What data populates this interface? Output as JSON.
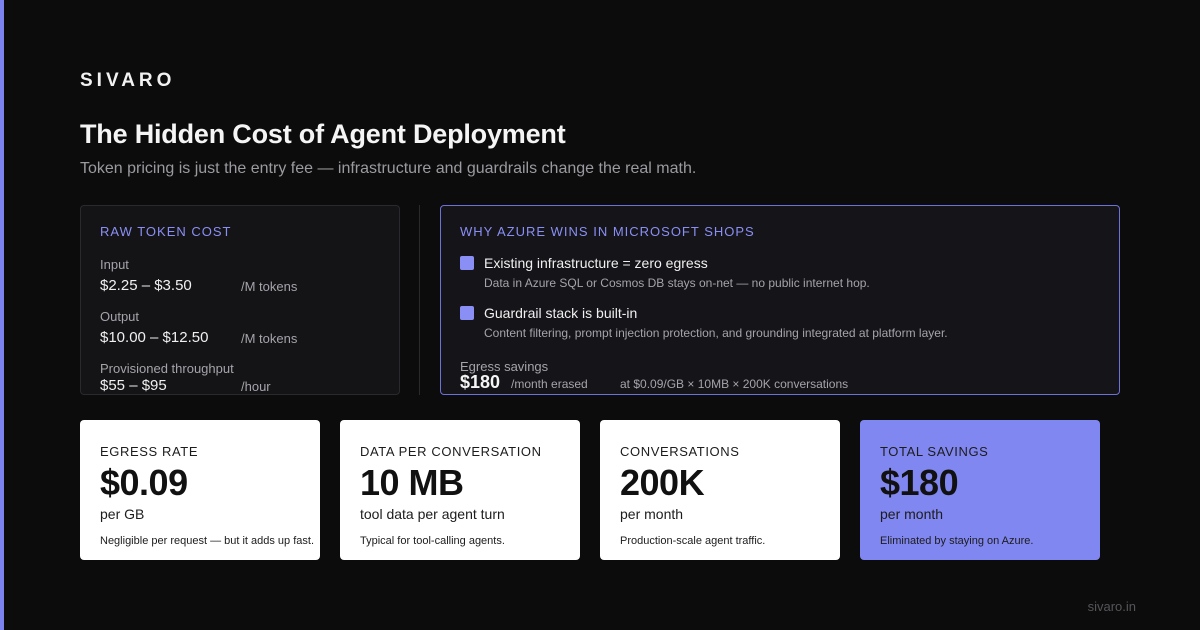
{
  "brand": "SIVARO",
  "title": "The Hidden Cost of Agent Deployment",
  "subtitle": "Token pricing is just the entry fee — infrastructure and guardrails change the real math.",
  "raw_cost": {
    "label": "RAW TOKEN COST",
    "rows": [
      {
        "label": "Input",
        "value": "$2.25 – $3.50",
        "unit": "/M tokens"
      },
      {
        "label": "Output",
        "value": "$10.00 – $12.50",
        "unit": "/M tokens"
      },
      {
        "label": "Provisioned throughput",
        "value": "$55 – $95",
        "unit": "/hour"
      }
    ]
  },
  "azure": {
    "label": "WHY AZURE WINS IN MICROSOFT SHOPS",
    "points": [
      {
        "title": "Existing infrastructure = zero egress",
        "desc": "Data in Azure SQL or Cosmos DB stays on-net — no public internet hop."
      },
      {
        "title": "Guardrail stack is built-in",
        "desc": "Content filtering, prompt injection protection, and grounding integrated at platform layer."
      }
    ],
    "savings_label": "Egress savings",
    "savings_value": "$180",
    "savings_unit": "/month erased",
    "savings_note": "at $0.09/GB × 10MB × 200K conversations"
  },
  "cards": [
    {
      "label": "EGRESS RATE",
      "value": "$0.09",
      "unit": "per GB",
      "note": "Negligible per request — but it adds up fast."
    },
    {
      "label": "DATA PER CONVERSATION",
      "value": "10 MB",
      "unit": "tool data per agent turn",
      "note": "Typical for tool-calling agents."
    },
    {
      "label": "CONVERSATIONS",
      "value": "200K",
      "unit": "per month",
      "note": "Production-scale agent traffic."
    },
    {
      "label": "TOTAL SAVINGS",
      "value": "$180",
      "unit": "per month",
      "note": "Eliminated by staying on Azure."
    }
  ],
  "footer": "sivaro.in",
  "colors": {
    "accent": "#7c83ee",
    "highlight_card": "#8187f0",
    "background": "#0c0c0c"
  }
}
